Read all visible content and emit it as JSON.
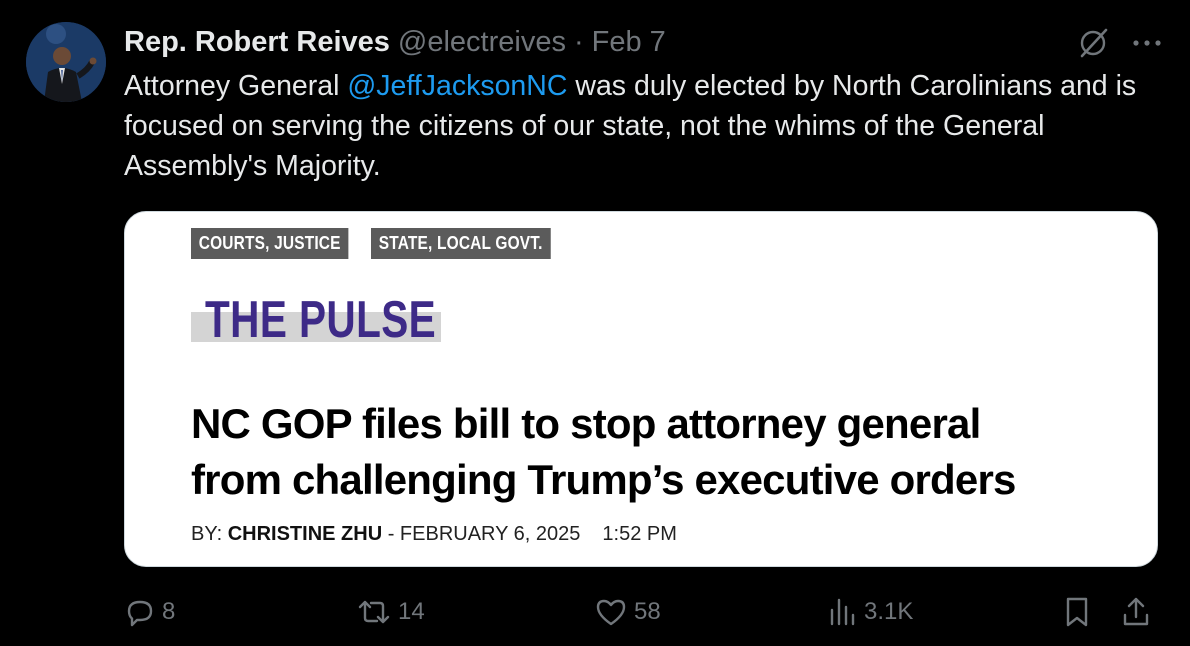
{
  "author": {
    "name": "Rep. Robert Reives",
    "handle": "@electreives",
    "separator": "·",
    "date": "Feb 7"
  },
  "tweet": {
    "text_before": "Attorney General ",
    "mention": "@JeffJacksonNC",
    "text_after": " was duly elected by North Carolinians and is focused on serving the citizens of our state, not the whims of the General Assembly's Majority."
  },
  "card": {
    "tags": [
      "COURTS, JUSTICE",
      "STATE, LOCAL GOVT."
    ],
    "section": "THE PULSE",
    "headline_line1": "NC GOP files bill to stop attorney general",
    "headline_line2": "from challenging Trump’s executive orders",
    "byline_prefix": "BY: ",
    "byline_author": "CHRISTINE ZHU",
    "byline_date": " - FEBRUARY 6, 2025",
    "byline_time": "1:52 PM"
  },
  "actions": {
    "replies": "8",
    "reposts": "14",
    "likes": "58",
    "views": "3.1K"
  },
  "icons": {
    "grok": "grok-icon",
    "more": "more-icon",
    "reply": "reply-icon",
    "repost": "repost-icon",
    "like": "heart-icon",
    "views": "views-icon",
    "bookmark": "bookmark-icon",
    "share": "share-icon"
  },
  "colors": {
    "background": "#000000",
    "text": "#e7e9ea",
    "secondary": "#71767b",
    "link": "#1d9bf0",
    "pulse_purple": "#3d2a87"
  }
}
